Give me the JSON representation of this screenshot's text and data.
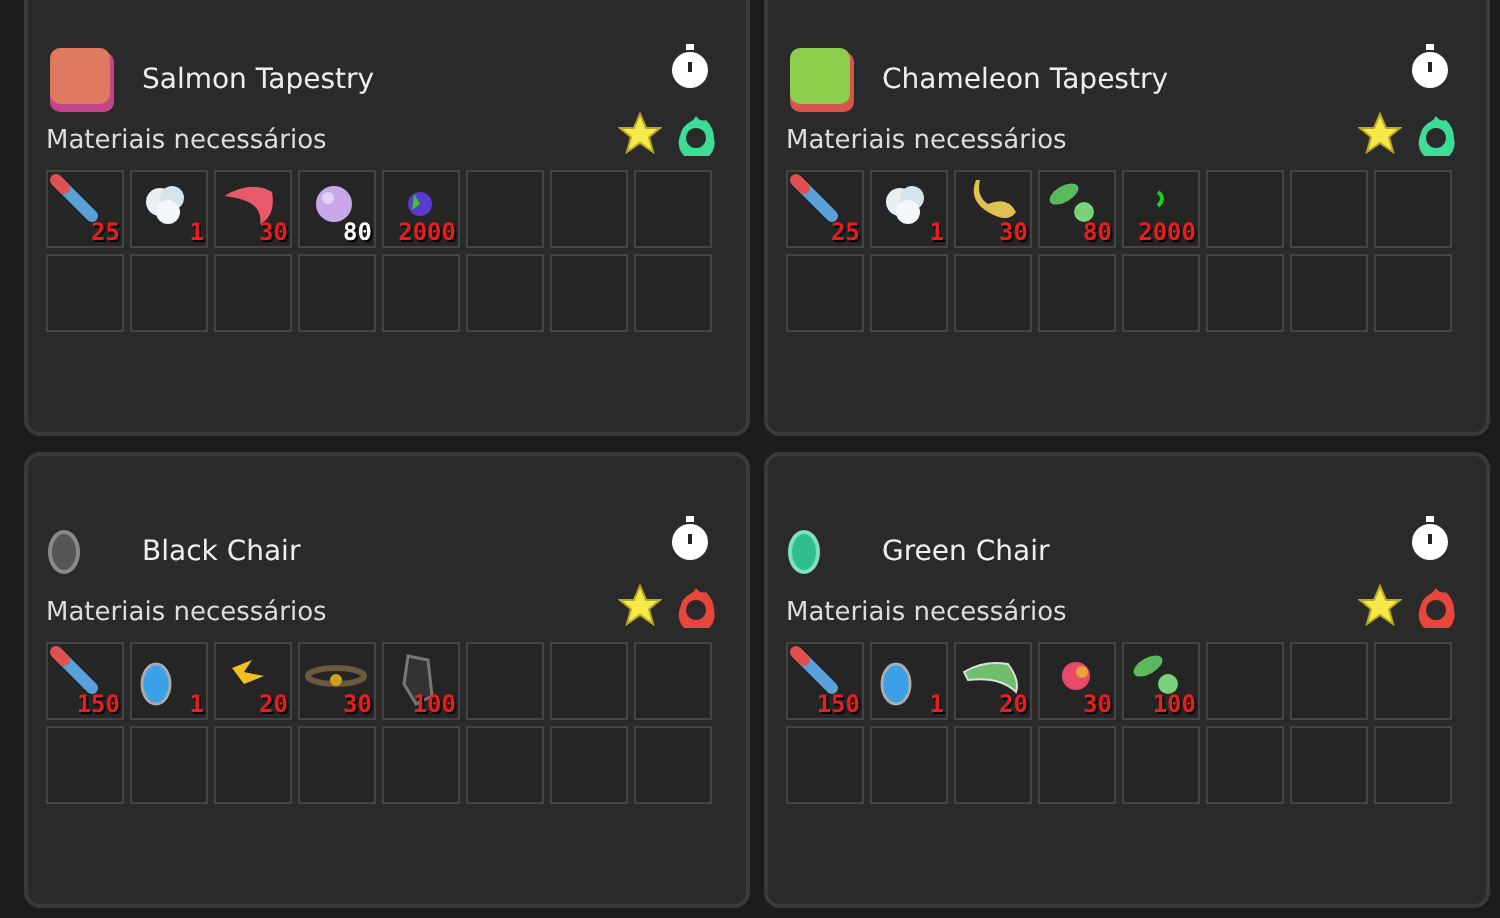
{
  "recipes": [
    {
      "title": "Salmon Tapestry",
      "section_label": "Materiais necessários",
      "color": "#3ddc97",
      "materials": [
        {
          "kind": "pencil",
          "count": "25",
          "enough": false
        },
        {
          "kind": "cotton",
          "count": "1",
          "enough": false
        },
        {
          "kind": "claw",
          "count": "30",
          "enough": false
        },
        {
          "kind": "orb",
          "count": "80",
          "enough": true
        },
        {
          "kind": "gem",
          "count": "2000",
          "enough": false
        }
      ]
    },
    {
      "title": "Chameleon Tapestry",
      "section_label": "Materiais necessários",
      "color": "#3ddc97",
      "materials": [
        {
          "kind": "pencil",
          "count": "25",
          "enough": false
        },
        {
          "kind": "cotton",
          "count": "1",
          "enough": false
        },
        {
          "kind": "tail",
          "count": "30",
          "enough": false
        },
        {
          "kind": "leaf",
          "count": "80",
          "enough": false
        },
        {
          "kind": "sprout",
          "count": "2000",
          "enough": false
        }
      ]
    },
    {
      "title": "Black Chair",
      "section_label": "Materiais necessários",
      "color": "#e8453c",
      "materials": [
        {
          "kind": "pencil",
          "count": "150",
          "enough": false
        },
        {
          "kind": "shell",
          "count": "1",
          "enough": false
        },
        {
          "kind": "wing",
          "count": "20",
          "enough": false
        },
        {
          "kind": "belt",
          "count": "30",
          "enough": false
        },
        {
          "kind": "stone",
          "count": "100",
          "enough": false
        }
      ]
    },
    {
      "title": "Green Chair",
      "section_label": "Materiais necessários",
      "color": "#e8453c",
      "materials": [
        {
          "kind": "pencil",
          "count": "150",
          "enough": false
        },
        {
          "kind": "shell",
          "count": "1",
          "enough": false
        },
        {
          "kind": "fin",
          "count": "20",
          "enough": false
        },
        {
          "kind": "flower",
          "count": "30",
          "enough": false
        },
        {
          "kind": "leaf",
          "count": "100",
          "enough": false
        }
      ]
    }
  ]
}
